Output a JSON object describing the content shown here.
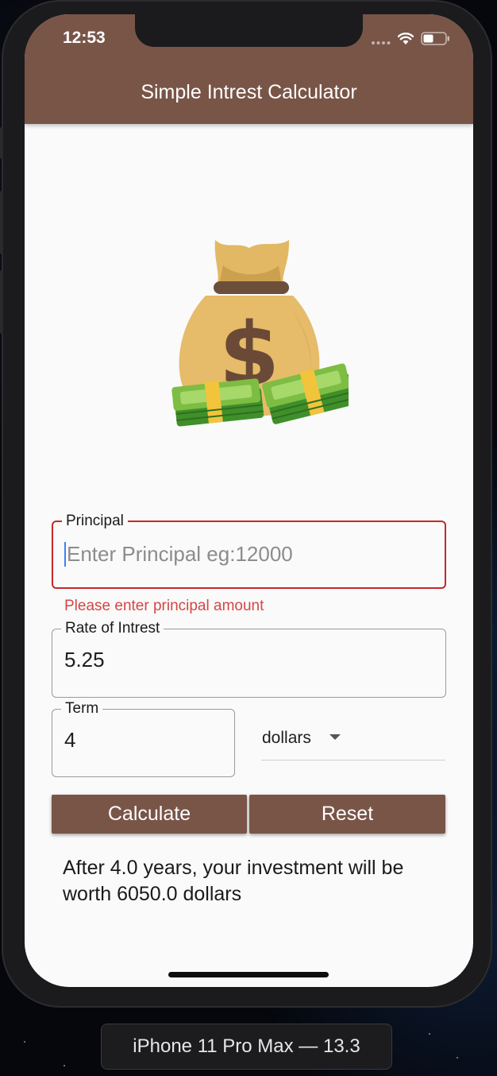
{
  "status_bar": {
    "time": "12:53"
  },
  "app_bar": {
    "title": "Simple Intrest Calculator"
  },
  "image": {
    "icon": "money-bag-icon"
  },
  "principal_field": {
    "label": "Principal",
    "value": "",
    "placeholder": "Enter Principal eg:12000",
    "error": "Please enter principal amount",
    "state": "focused-error"
  },
  "rate_field": {
    "label": "Rate of Intrest",
    "value": "5.25"
  },
  "term_field": {
    "label": "Term",
    "value": "4"
  },
  "currency_dropdown": {
    "selected": "dollars"
  },
  "buttons": {
    "calculate": "Calculate",
    "reset": "Reset"
  },
  "result": {
    "text": "After 4.0 years, your investment will be worth 6050.0 dollars"
  },
  "device_caption": "iPhone 11 Pro Max — 13.3",
  "colors": {
    "primary": "#795548",
    "error": "#c62828",
    "background": "#fafafa"
  }
}
